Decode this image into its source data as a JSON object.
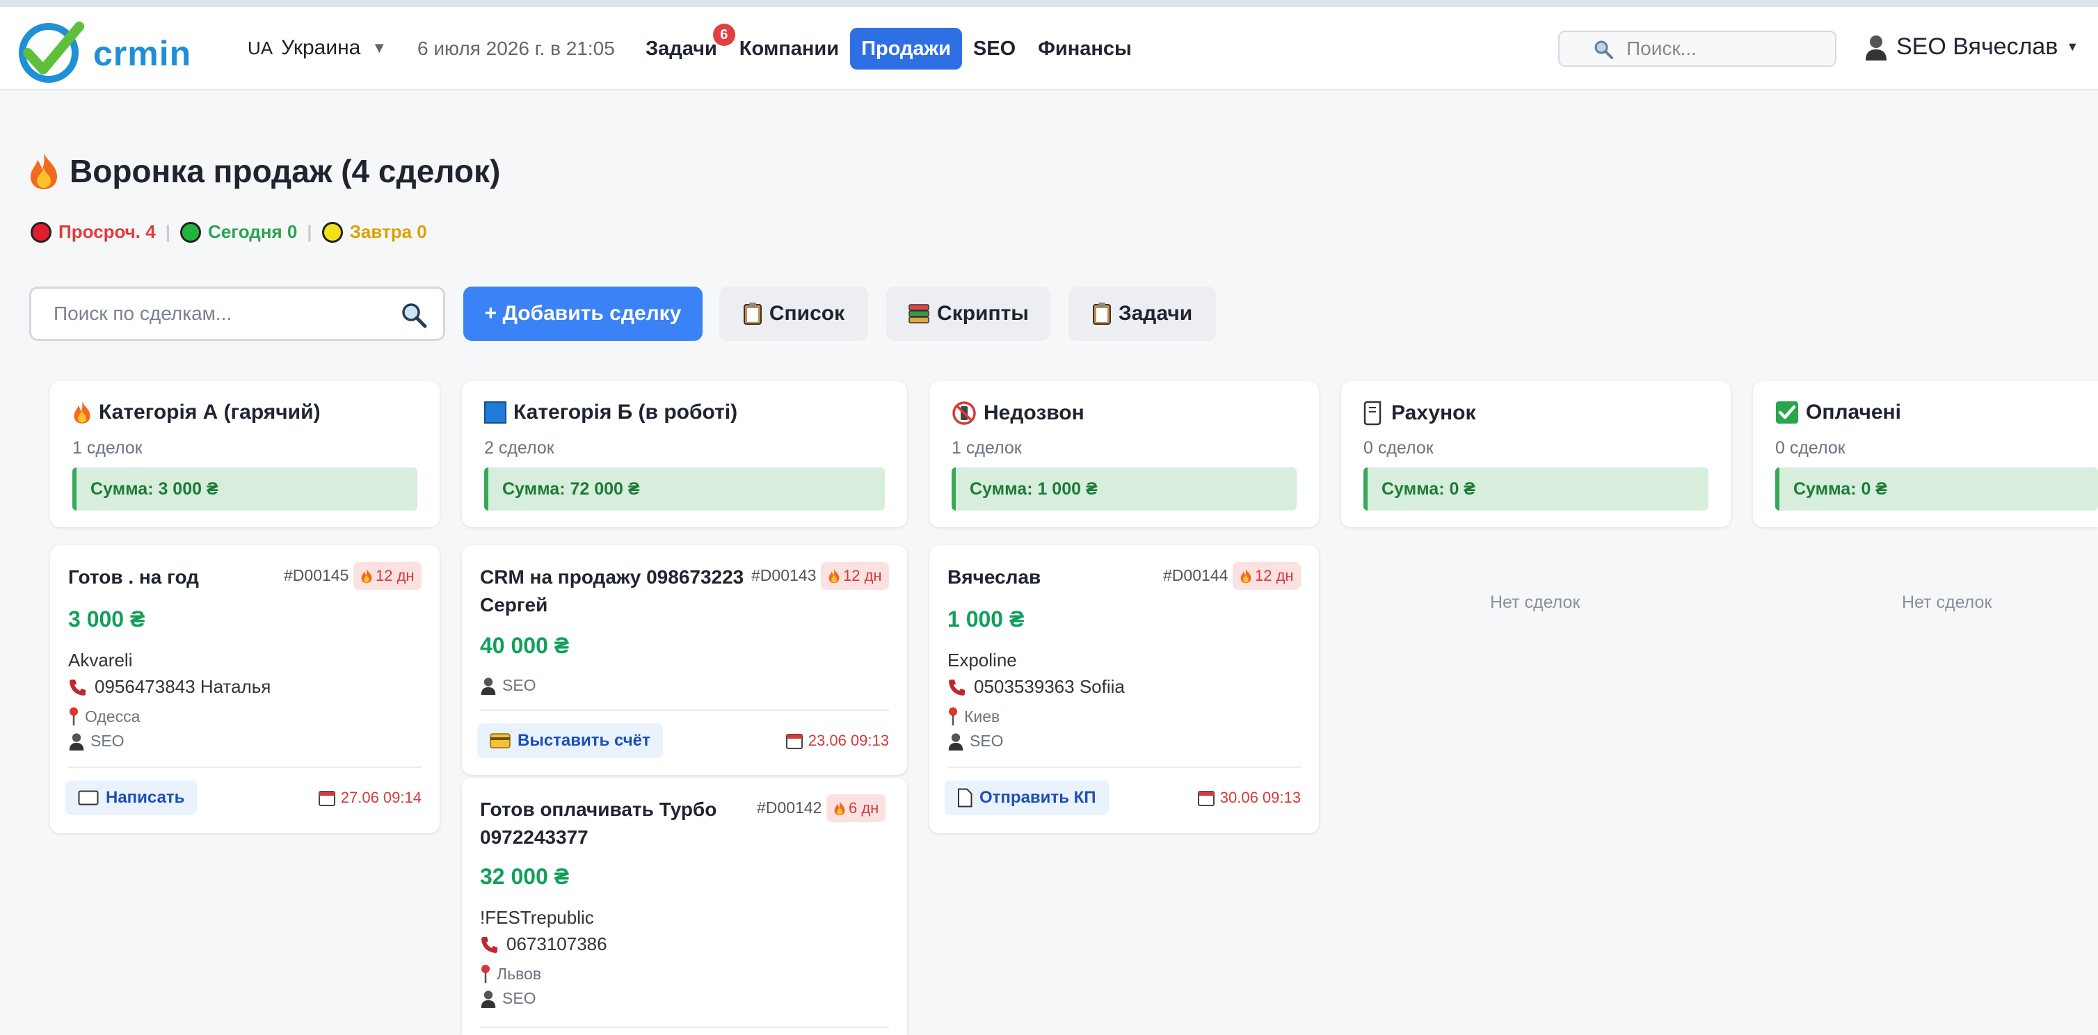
{
  "topbar": {
    "logo_text": "crmin",
    "region_code": "UA",
    "region_name": "Украина",
    "datetime": "6 июля 2026 г. в 21:05",
    "nav": [
      {
        "label": "Задачи",
        "badge": "6",
        "active": false
      },
      {
        "label": "Компании",
        "active": false
      },
      {
        "label": "Продажи",
        "active": true
      },
      {
        "label": "SEO",
        "active": false
      },
      {
        "label": "Финансы",
        "active": false
      }
    ],
    "search_placeholder": "Поиск...",
    "user_name": "SEO Вячеслав"
  },
  "page": {
    "title": "Воронка продаж (4 сделок)",
    "stats": {
      "overdue": "Просроч. 4",
      "today": "Сегодня 0",
      "tomorrow": "Завтра 0"
    }
  },
  "toolbar": {
    "search_placeholder": "Поиск по сделкам...",
    "add_label": "+ Добавить сделку",
    "list_label": "Список",
    "scripts_label": "Скрипты",
    "tasks_label": "Задачи"
  },
  "columns": [
    {
      "title": "Категорія А (гарячий)",
      "icon": "fire-icon",
      "count": "1 сделок",
      "sum": "Сумма: 3 000 ₴",
      "cards": [
        {
          "title": "Готов . на год",
          "id": "#D00145",
          "days": "12 дн",
          "amount": "3 000 ₴",
          "company": "Akvareli",
          "phone": "0956473843 Наталья",
          "city": "Одесса",
          "owner": "SEO",
          "action": "Написать",
          "date": "27.06 09:14"
        }
      ]
    },
    {
      "title": "Категорія Б (в роботі)",
      "icon": "blue-square-icon",
      "count": "2 сделок",
      "sum": "Сумма: 72 000 ₴",
      "cards": [
        {
          "title_line1": "CRM на продажу 098673223",
          "title_line2": "Сергей",
          "id": "#D00143",
          "days": "12 дн",
          "amount": "40 000 ₴",
          "owner": "SEO",
          "action": "Выставить счёт",
          "date": "23.06 09:13"
        },
        {
          "title_line1": "Готов оплачивать Турбо",
          "title_line2": "0972243377",
          "id": "#D00142",
          "days": "6 дн",
          "amount": "32 000 ₴",
          "company": "!FESTrepublic",
          "phone": "0673107386",
          "city": "Львов",
          "owner": "SEO"
        }
      ]
    },
    {
      "title": "Недозвон",
      "icon": "no-phone-icon",
      "count": "1 сделок",
      "sum": "Сумма: 1 000 ₴",
      "cards": [
        {
          "title": "Вячеслав",
          "id": "#D00144",
          "days": "12 дн",
          "amount": "1 000 ₴",
          "company": "Expoline",
          "phone": "0503539363 Sofiia",
          "city": "Киев",
          "owner": "SEO",
          "action": "Отправить КП",
          "date": "30.06 09:13"
        }
      ]
    },
    {
      "title": "Рахунок",
      "icon": "scroll-icon",
      "count": "0 сделок",
      "sum": "Сумма: 0 ₴",
      "empty": "Нет сделок"
    },
    {
      "title": "Оплачені",
      "icon": "check-box-icon",
      "count": "0 сделок",
      "sum": "Сумма: 0 ₴",
      "empty": "Нет сделок"
    }
  ],
  "colors": {
    "accent": "#2f6fe4",
    "primary_button": "#3b82f6",
    "amount_green": "#11a05a",
    "sum_bg": "#d6eedb",
    "danger": "#e23b3b"
  }
}
